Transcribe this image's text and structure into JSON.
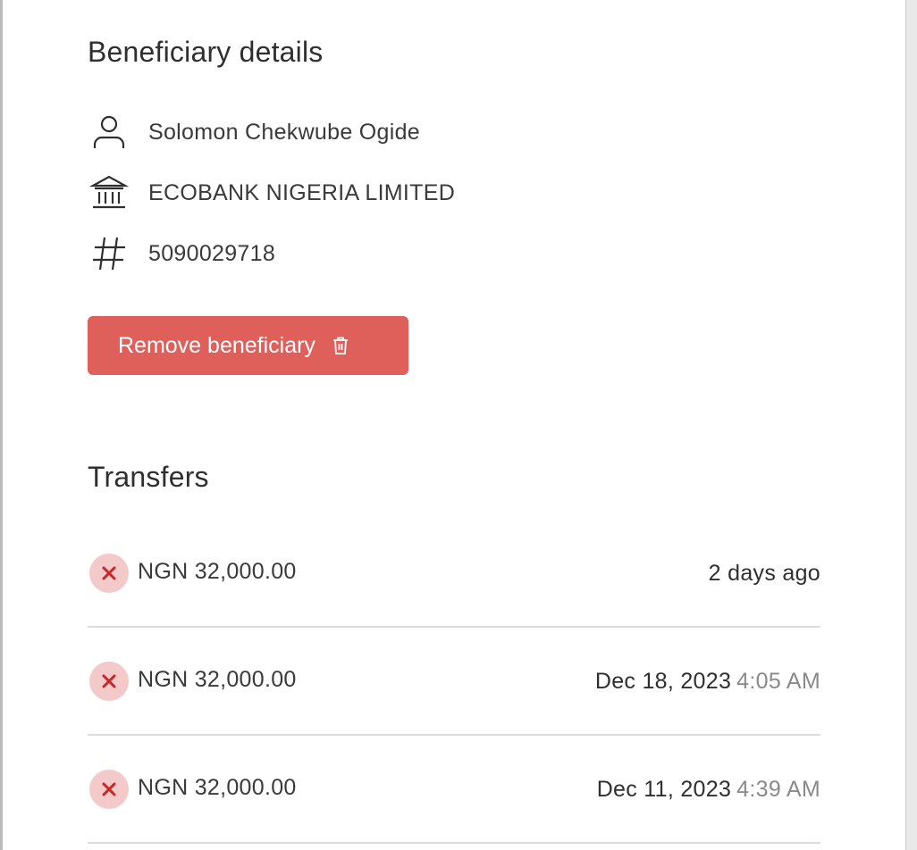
{
  "beneficiary": {
    "title": "Beneficiary details",
    "name": "Solomon Chekwube Ogide",
    "bank": "ECOBANK NIGERIA LIMITED",
    "account_number": "5090029718",
    "icons": {
      "name": "person-icon",
      "bank": "bank-icon",
      "account": "hash-icon"
    },
    "remove_label": "Remove beneficiary",
    "remove_icon": "trash-icon"
  },
  "transfers": {
    "title": "Transfers",
    "items": [
      {
        "status": "failed",
        "status_icon": "x-icon",
        "amount": "NGN 32,000.00",
        "date": "2 days ago",
        "time": ""
      },
      {
        "status": "failed",
        "status_icon": "x-icon",
        "amount": "NGN 32,000.00",
        "date": "Dec 18, 2023",
        "time": "4:05 AM"
      },
      {
        "status": "failed",
        "status_icon": "x-icon",
        "amount": "NGN 32,000.00",
        "date": "Dec 11, 2023",
        "time": "4:39 AM"
      }
    ]
  },
  "colors": {
    "danger_button": "#df5f5b",
    "status_failed_bg": "#f3c9c9",
    "status_failed_icon": "#c62828",
    "muted_time": "#8a8a8a"
  }
}
